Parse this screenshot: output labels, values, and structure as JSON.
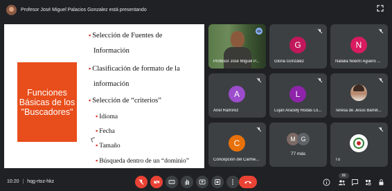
{
  "presenter_banner": "Profesor José Miguel Palacios Gonzalez está presentando",
  "slide": {
    "title": "Funciones Básicas de los \"Buscadores\"",
    "bullets": {
      "b1_line1": "Selección de Fuentes de",
      "b1_line2": "Información",
      "b2_line1": "Clasificación de formato de la",
      "b2_line2": "información",
      "b3": "Selección de “criterios”",
      "s1": "Idioma",
      "s2": "Fecha",
      "s3": "Tamaño",
      "s4": "Búsqueda dentro de un “dominio”"
    },
    "bullet_mark": "▪"
  },
  "tiles": {
    "speaker": {
      "name": "Profesor José Miguel P..."
    },
    "t1": {
      "initial": "G",
      "name": "Gloria González",
      "color": "#c2185b"
    },
    "t2": {
      "initial": "N",
      "name": "Natalia Noemí Aguero ...",
      "color": "#d81b60"
    },
    "t3": {
      "initial": "A",
      "name": "Ariel Ramírez",
      "color": "#9c4dcc"
    },
    "t4": {
      "initial": "L",
      "name": "Lujan Aracely Rodas Ló...",
      "color": "#8e24aa"
    },
    "t5": {
      "name": "Teresa de Jesús Barret..."
    },
    "t6": {
      "initial": "C",
      "name": "Concepción del Carme...",
      "color": "#e8710a"
    },
    "t7": {
      "initial_a": "M",
      "initial_b": "G",
      "label": "77 más",
      "color_a": "#7b6a63",
      "color_b": "#5f6368"
    },
    "t8": {
      "name": "Tú"
    }
  },
  "bottom": {
    "time": "10:20",
    "code": "hqg-rtoz-hkz",
    "participant_count": "86"
  },
  "colors": {
    "background": "#202124",
    "tile": "#3c4043",
    "danger": "#ea4335",
    "slide_accent": "#e84e1b"
  },
  "icons": [
    "presenter-avatar",
    "fullscreen-icon",
    "mic-off-icon",
    "camera-off-icon",
    "captions-icon",
    "raise-hand-icon",
    "present-icon",
    "more-icon",
    "hang-up-icon",
    "info-icon",
    "people-icon",
    "chat-icon",
    "activities-icon",
    "lock-icon"
  ]
}
